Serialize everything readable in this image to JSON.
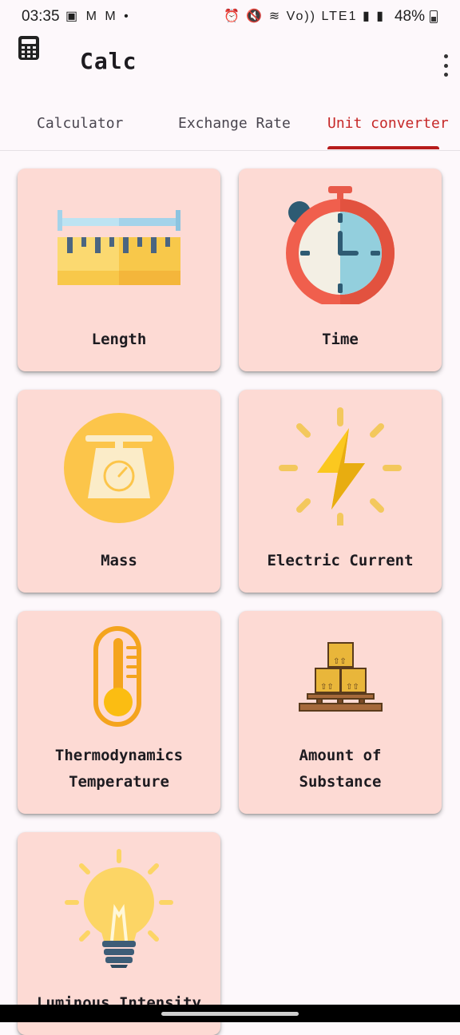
{
  "status_bar": {
    "time": "03:35",
    "left_icons": "▣ M M •",
    "right_icons": "⏰ 🔇 ≋ Vo)) LTE1 ▮ ▮",
    "battery": "48%"
  },
  "app": {
    "title": "Calc"
  },
  "tabs": [
    {
      "label": "Calculator",
      "active": false
    },
    {
      "label": "Exchange Rate",
      "active": false
    },
    {
      "label": "Unit converter",
      "active": true
    }
  ],
  "colors": {
    "accent": "#b71c1c",
    "card_bg": "#fddad4",
    "page_bg": "#fdf8fb"
  },
  "units": [
    {
      "lines": [
        "Length"
      ],
      "icon": "ruler-icon"
    },
    {
      "lines": [
        "Time"
      ],
      "icon": "stopwatch-icon"
    },
    {
      "lines": [
        "Mass"
      ],
      "icon": "scale-icon"
    },
    {
      "lines": [
        "Electric Current"
      ],
      "icon": "lightning-icon"
    },
    {
      "lines": [
        "Thermodynamics",
        "Temperature"
      ],
      "icon": "thermometer-icon"
    },
    {
      "lines": [
        "Amount of",
        "Substance"
      ],
      "icon": "boxes-icon"
    },
    {
      "lines": [
        "Luminous Intensity"
      ],
      "icon": "lightbulb-icon"
    }
  ]
}
